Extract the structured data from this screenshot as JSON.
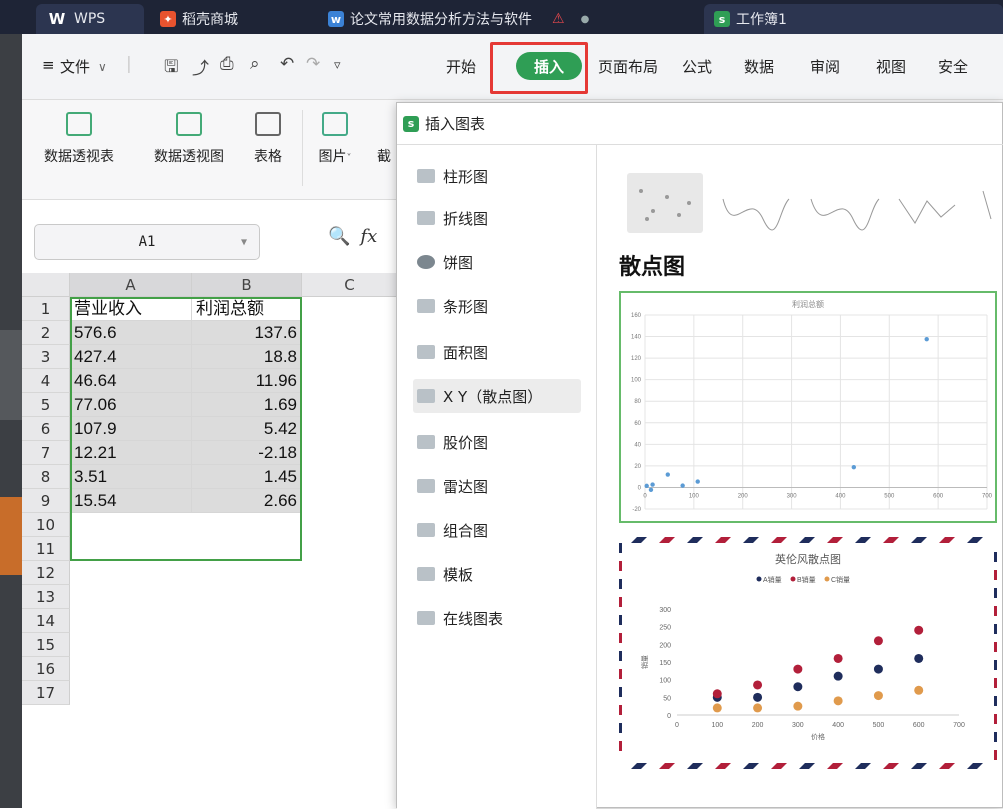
{
  "window": {
    "tabs": [
      {
        "label": "WPS"
      },
      {
        "label": "稻壳商城"
      },
      {
        "label": "论文常用数据分析方法与软件"
      },
      {
        "label": "工作簿1"
      }
    ]
  },
  "menu": {
    "file_label": "文件",
    "tabs": [
      "开始",
      "插入",
      "页面布局",
      "公式",
      "数据",
      "审阅",
      "视图",
      "安全"
    ],
    "active_tab": "插入",
    "accent": "#2f9e55",
    "highlight": "#e53935"
  },
  "toolbar": {
    "buttons": [
      "数据透视表",
      "数据透视图",
      "表格",
      "图片",
      "截"
    ]
  },
  "formula_bar": {
    "name_box": "A1",
    "fx_label": "fx"
  },
  "sheet": {
    "columns": [
      "A",
      "B",
      "C"
    ],
    "rows": [
      "1",
      "2",
      "3",
      "4",
      "5",
      "6",
      "7",
      "8",
      "9",
      "10",
      "11",
      "12",
      "13",
      "14",
      "15",
      "16",
      "17"
    ],
    "headers": [
      "营业收入",
      "利润总额"
    ],
    "data": [
      [
        "576.6",
        "137.6"
      ],
      [
        "427.4",
        "18.8"
      ],
      [
        "46.64",
        "11.96"
      ],
      [
        "77.06",
        "1.69"
      ],
      [
        "107.9",
        "5.42"
      ],
      [
        "12.21",
        "-2.18"
      ],
      [
        "3.51",
        "1.45"
      ],
      [
        "15.54",
        "2.66"
      ]
    ]
  },
  "dialog": {
    "title": "插入图表",
    "chart_types": [
      "柱形图",
      "折线图",
      "饼图",
      "条形图",
      "面积图",
      "X Y（散点图）",
      "股价图",
      "雷达图",
      "组合图",
      "模板",
      "在线图表"
    ],
    "selected": "X Y（散点图）",
    "heading": "散点图"
  },
  "chart_data": [
    {
      "type": "scatter",
      "title": "利润总额",
      "xlim": [
        0,
        700
      ],
      "ylim": [
        -20,
        160
      ],
      "xticks": [
        0,
        100,
        200,
        300,
        400,
        500,
        600,
        700
      ],
      "yticks": [
        -20,
        0,
        20,
        40,
        60,
        80,
        100,
        120,
        140,
        160
      ],
      "series": [
        {
          "color": "#5b9bd5",
          "x": [
            576.6,
            427.4,
            46.64,
            77.06,
            107.9,
            12.21,
            3.51,
            15.54
          ],
          "y": [
            137.6,
            18.8,
            11.96,
            1.69,
            5.42,
            -2.18,
            1.45,
            2.66
          ]
        }
      ]
    },
    {
      "type": "scatter",
      "title": "英伦风散点图",
      "xlabel": "价格",
      "ylabel": "销量",
      "xlim": [
        0,
        700
      ],
      "ylim": [
        0,
        300
      ],
      "xticks": [
        0,
        100,
        200,
        300,
        400,
        500,
        600,
        700
      ],
      "yticks": [
        0,
        50,
        100,
        150,
        200,
        250,
        300
      ],
      "legend": "top",
      "series": [
        {
          "name": "A销量",
          "color": "#1f2d5c",
          "x": [
            100,
            200,
            300,
            400,
            500,
            600
          ],
          "y": [
            50,
            50,
            80,
            110,
            130,
            160
          ]
        },
        {
          "name": "B销量",
          "color": "#b21f3a",
          "x": [
            100,
            200,
            300,
            400,
            500,
            600
          ],
          "y": [
            60,
            85,
            130,
            160,
            210,
            240
          ]
        },
        {
          "name": "C销量",
          "color": "#e09a4c",
          "x": [
            100,
            200,
            300,
            400,
            500,
            600
          ],
          "y": [
            20,
            20,
            25,
            40,
            55,
            70
          ]
        }
      ]
    }
  ]
}
